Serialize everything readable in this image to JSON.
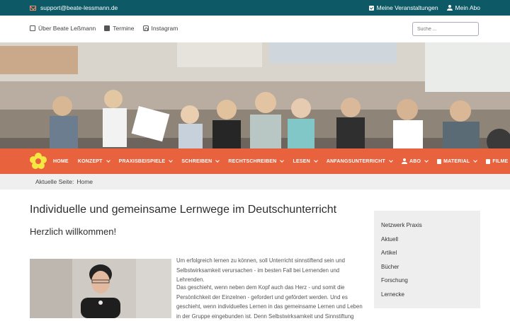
{
  "topbar": {
    "email": "support@beate-lessmann.de",
    "events_label": "Meine Veranstaltungen",
    "subscription_label": "Mein Abo"
  },
  "subheader": {
    "links": [
      "Über Beate Leßmann",
      "Termine",
      "Instagram"
    ],
    "search_placeholder": "Suche ..."
  },
  "nav": {
    "items": [
      {
        "label": "HOME"
      },
      {
        "label": "KONZEPT"
      },
      {
        "label": "PRAXISBEISPIELE"
      },
      {
        "label": "SCHREIBEN"
      },
      {
        "label": "RECHTSCHREIBEN"
      },
      {
        "label": "LESEN"
      },
      {
        "label": "ANFANGSUNTERRICHT"
      },
      {
        "label": "ABO"
      },
      {
        "label": "MATERIAL"
      },
      {
        "label": "FILME"
      }
    ]
  },
  "breadcrumb": {
    "prefix": "Aktuelle Seite:",
    "current": "Home"
  },
  "main": {
    "title": "Individuelle und gemeinsame Lernwege im Deutschunterricht",
    "welcome": "Herzlich willkommen!",
    "paragraphs": [
      "Um erfolgreich lernen zu können, soll Unterricht sinnstiftend sein und Selbstwirksamkeit verursachen - im besten Fall bei Lernenden und Lehrenden.",
      "Das geschieht, wenn neben dem Kopf auch das Herz - und somit die Persönlichkeit der Einzelnen - gefordert und gefördert werden. Und es geschieht, wenn individuelles Lernen in das gemeinsame Lernen und Leben in der Gruppe eingebunden ist. Denn Selbstwirksamkeit und Sinnstiftung"
    ]
  },
  "sidebar": {
    "items": [
      "Netzwerk Praxis",
      "Aktuell",
      "Artikel",
      "Bücher",
      "Forschung",
      "Lernecke"
    ]
  },
  "colors": {
    "topbar": "#0d5a66",
    "nav": "#e8623e",
    "logo": "#f5e642"
  }
}
